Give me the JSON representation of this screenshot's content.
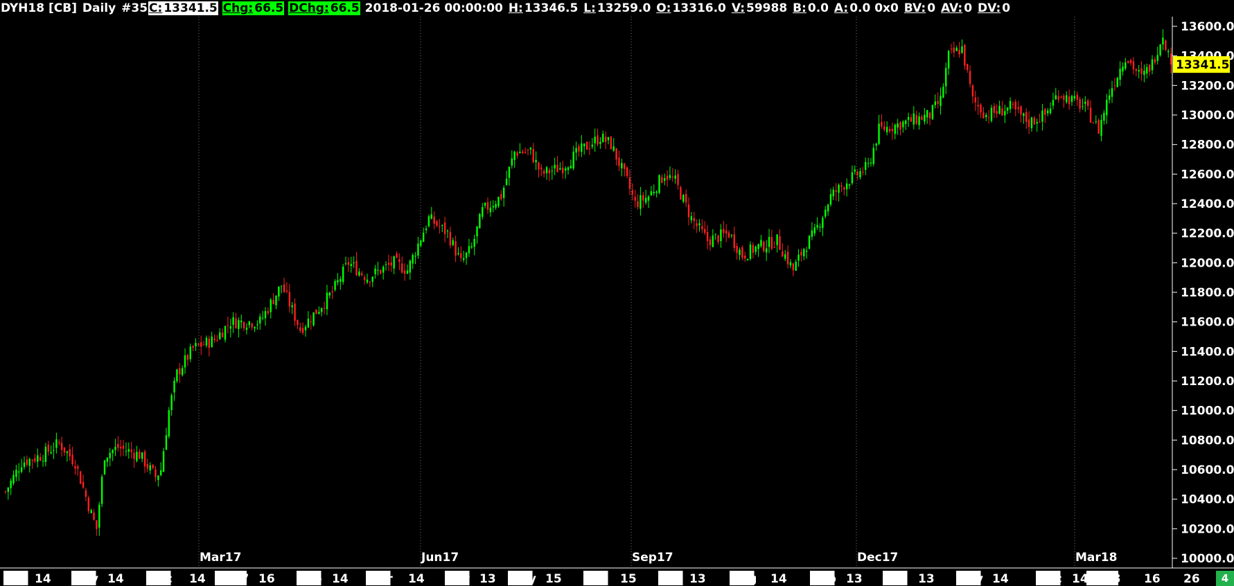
{
  "header": {
    "symbol": "DYH18 [CB]",
    "interval": "Daily",
    "number": "#35",
    "c_label": "C:",
    "c_value": "13341.5",
    "chg_label": "Chg:",
    "chg_value": "66.5",
    "dchg_label": "DChg:",
    "dchg_value": "66.5",
    "datetime": "2018-01-26 00:00:00",
    "h_label": "H:",
    "h_value": "13346.5",
    "l_label": "L:",
    "l_value": "13259.0",
    "o_label": "O:",
    "o_value": "13316.0",
    "v_label": "V:",
    "v_value": "59988",
    "b_label": "B:",
    "b_value": "0.0",
    "a_label": "A:",
    "a_value": "0.0 0x0",
    "bv_label": "BV:",
    "bv_value": "0",
    "av_label": "AV:",
    "av_value": "0",
    "dv_label": "DV:",
    "dv_value": "0"
  },
  "corner_badge": "4",
  "chart_data": {
    "type": "candlestick",
    "ylim": [
      10000,
      13700
    ],
    "y_ticks": [
      "10000.0",
      "10200.0",
      "10400.0",
      "10600.0",
      "10800.0",
      "11000.0",
      "11200.0",
      "11400.0",
      "11600.0",
      "11800.0",
      "12000.0",
      "12200.0",
      "12400.0",
      "12600.0",
      "12800.0",
      "13000.0",
      "13200.0",
      "13400.0",
      "13600.0"
    ],
    "last_price_label": "13341.5",
    "last_price": 13341.5,
    "contract_labels": [
      "Mar17",
      "Jun17",
      "Sep17",
      "Dec17",
      "Mar18"
    ],
    "x_labels": [
      {
        "text": "Oct",
        "boxed": true
      },
      {
        "text": "14",
        "boxed": false
      },
      {
        "text": "Nov",
        "boxed": true
      },
      {
        "text": "14",
        "boxed": false
      },
      {
        "text": "Dec",
        "boxed": true
      },
      {
        "text": "14",
        "boxed": false
      },
      {
        "text": "2017",
        "boxed": true
      },
      {
        "text": "16",
        "boxed": false
      },
      {
        "text": "Feb",
        "boxed": true
      },
      {
        "text": "14",
        "boxed": false
      },
      {
        "text": "Mar",
        "boxed": true
      },
      {
        "text": "14",
        "boxed": false
      },
      {
        "text": "Apr",
        "boxed": true
      },
      {
        "text": "13",
        "boxed": false
      },
      {
        "text": "May",
        "boxed": true
      },
      {
        "text": "15",
        "boxed": false
      },
      {
        "text": "Jun",
        "boxed": true
      },
      {
        "text": "15",
        "boxed": false
      },
      {
        "text": "Jul",
        "boxed": true
      },
      {
        "text": "13",
        "boxed": false
      },
      {
        "text": "Aug",
        "boxed": true
      },
      {
        "text": "14",
        "boxed": false
      },
      {
        "text": "Sep",
        "boxed": true
      },
      {
        "text": "13",
        "boxed": false
      },
      {
        "text": "Oct",
        "boxed": true
      },
      {
        "text": "13",
        "boxed": false
      },
      {
        "text": "Nov",
        "boxed": true
      },
      {
        "text": "14",
        "boxed": false
      },
      {
        "text": "Dec",
        "boxed": true
      },
      {
        "text": "14",
        "boxed": false
      },
      {
        "text": "2018",
        "boxed": true
      },
      {
        "text": "16",
        "boxed": false
      },
      {
        "text": "26",
        "boxed": false
      }
    ],
    "trend": [
      [
        0,
        10450
      ],
      [
        6,
        10650
      ],
      [
        14,
        10700
      ],
      [
        20,
        10780
      ],
      [
        26,
        10650
      ],
      [
        32,
        10300
      ],
      [
        34,
        10200
      ],
      [
        37,
        10700
      ],
      [
        42,
        10750
      ],
      [
        50,
        10700
      ],
      [
        56,
        10550
      ],
      [
        58,
        10600
      ],
      [
        61,
        11000
      ],
      [
        64,
        11250
      ],
      [
        70,
        11420
      ],
      [
        78,
        11480
      ],
      [
        84,
        11600
      ],
      [
        95,
        11600
      ],
      [
        103,
        11850
      ],
      [
        110,
        11550
      ],
      [
        115,
        11650
      ],
      [
        122,
        11800
      ],
      [
        128,
        12000
      ],
      [
        135,
        11900
      ],
      [
        145,
        12000
      ],
      [
        150,
        11950
      ],
      [
        158,
        12300
      ],
      [
        165,
        12200
      ],
      [
        170,
        12000
      ],
      [
        174,
        12100
      ],
      [
        178,
        12350
      ],
      [
        185,
        12450
      ],
      [
        190,
        12750
      ],
      [
        196,
        12750
      ],
      [
        200,
        12600
      ],
      [
        208,
        12650
      ],
      [
        214,
        12750
      ],
      [
        222,
        12850
      ],
      [
        226,
        12800
      ],
      [
        232,
        12550
      ],
      [
        235,
        12400
      ],
      [
        240,
        12450
      ],
      [
        246,
        12600
      ],
      [
        250,
        12550
      ],
      [
        256,
        12300
      ],
      [
        262,
        12150
      ],
      [
        270,
        12200
      ],
      [
        275,
        12050
      ],
      [
        280,
        12100
      ],
      [
        288,
        12150
      ],
      [
        294,
        11950
      ],
      [
        298,
        12100
      ],
      [
        302,
        12200
      ],
      [
        308,
        12450
      ],
      [
        314,
        12550
      ],
      [
        318,
        12600
      ],
      [
        322,
        12650
      ],
      [
        326,
        12900
      ],
      [
        336,
        12950
      ],
      [
        345,
        13000
      ],
      [
        349,
        13100
      ],
      [
        352,
        13400
      ],
      [
        357,
        13450
      ],
      [
        361,
        13100
      ],
      [
        366,
        13000
      ],
      [
        375,
        13050
      ],
      [
        382,
        12950
      ],
      [
        388,
        13000
      ],
      [
        393,
        13150
      ],
      [
        398,
        13100
      ],
      [
        403,
        13050
      ],
      [
        408,
        12900
      ],
      [
        412,
        13150
      ],
      [
        418,
        13400
      ],
      [
        424,
        13250
      ],
      [
        428,
        13350
      ],
      [
        432,
        13550
      ],
      [
        435,
        13341.5
      ]
    ],
    "grid": false
  }
}
